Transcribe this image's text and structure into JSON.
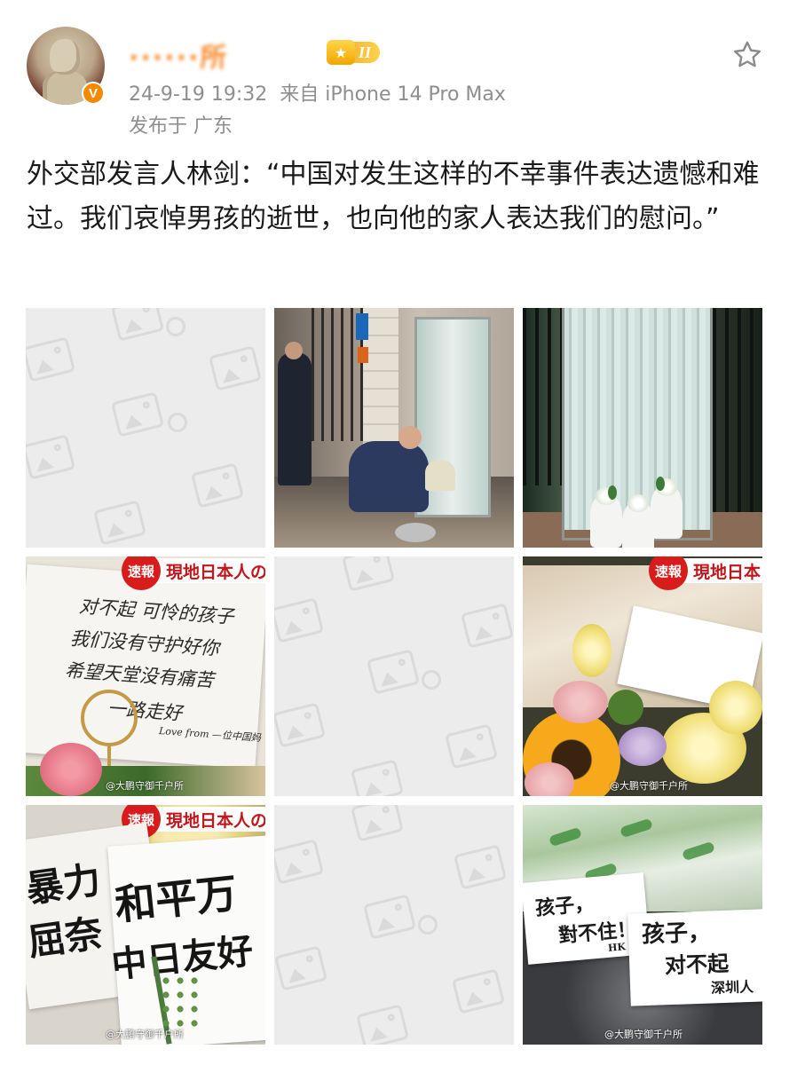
{
  "post": {
    "username": "······所",
    "level_badge": "II",
    "verified_badge": "V",
    "timestamp": "24-9-19 19:32",
    "source": "来自 iPhone 14 Pro Max",
    "location": "发布于 广东",
    "text": "外交部发言人林剑：“中国对发生这样的不幸事件表达遗憾和难过。我们哀悼男孩的逝世，也向他的家人表达我们的慰问。”"
  },
  "icons": {
    "favorite": "star-outline-icon",
    "placeholder": "image-placeholder-icon"
  },
  "colors": {
    "username": "#f58a2a",
    "meta": "#8e8e8e",
    "verified": "#f28a00",
    "placeholder_bg": "#ececec",
    "news_tag_red": "#d81b1b"
  },
  "images": {
    "news_tag": "速報",
    "news_title_a": "現地日本人の",
    "news_title_b": "現地日本",
    "news_title_c": "現地日本人の",
    "watermark": "@大鹏守御千户所",
    "note_card": {
      "line1": "对不起 可怜的孩子",
      "line2": "我们没有守护好你",
      "line3": "希望天堂没有痛苦",
      "line4": "一路走好",
      "signature": "Love from —位中国妈"
    },
    "calligraphy": {
      "left_line1": "暴力",
      "left_line2": "屈奈",
      "right_line1": "和平万",
      "right_line2": "中日友好"
    },
    "ground_notes": {
      "note1_line1": "孩子，",
      "note1_line2": "對不住！",
      "note1_sign": "HK",
      "note2_line1": "孩子，",
      "note2_line2": "对不起",
      "note2_sign": "深圳人"
    }
  }
}
